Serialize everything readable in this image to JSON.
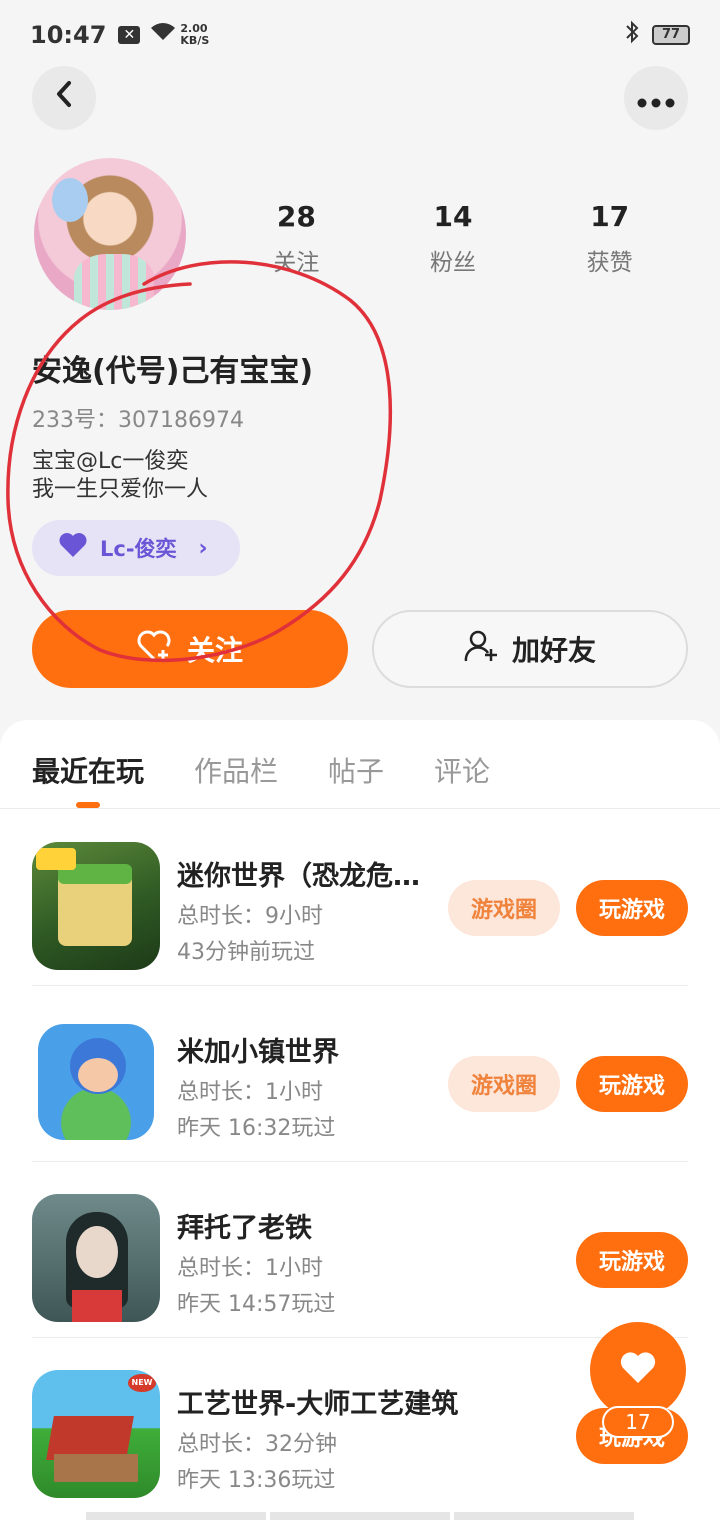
{
  "status_bar": {
    "time": "10:47",
    "network_speed_value": "2.00",
    "network_speed_unit": "KB/S",
    "battery": "77",
    "icons": [
      "notification-x-icon",
      "wifi-icon",
      "bluetooth-icon",
      "battery-icon"
    ]
  },
  "header": {
    "back_icon": "back-chevron-icon",
    "more_icon": "more-dots-icon"
  },
  "profile": {
    "stats": [
      {
        "value": "28",
        "label": "关注"
      },
      {
        "value": "14",
        "label": "粉丝"
      },
      {
        "value": "17",
        "label": "获赞"
      }
    ],
    "nickname": "安逸(代号)己有宝宝)",
    "uid": "233号：307186974",
    "bio_line1": "宝宝@Lc一俊奕",
    "bio_line2": "我一生只爱你一人",
    "partner_label": "Lc-俊奕",
    "follow_label": "关注",
    "add_friend_label": "加好友"
  },
  "tabs": [
    "最近在玩",
    "作品栏",
    "帖子",
    "评论"
  ],
  "games": [
    {
      "title": "迷你世界（恐龙危…",
      "playtime": "总时长：9小时",
      "last_played": "43分钟前玩过",
      "has_circle": true
    },
    {
      "title": "米加小镇世界",
      "playtime": "总时长：1小时",
      "last_played": "昨天 16:32玩过",
      "has_circle": true
    },
    {
      "title": "拜托了老铁",
      "playtime": "总时长：1小时",
      "last_played": "昨天 14:57玩过",
      "has_circle": false
    },
    {
      "title": "工艺世界-大师工艺建筑",
      "playtime": "总时长：32分钟",
      "last_played": "昨天 13:36玩过",
      "has_circle": false
    }
  ],
  "buttons": {
    "circle": "游戏圈",
    "play": "玩游戏"
  },
  "fab": {
    "count": "17"
  },
  "colors": {
    "accent": "#ff6f0f",
    "partner_purple": "#6a55d6",
    "annotation_red": "#e0313a"
  }
}
